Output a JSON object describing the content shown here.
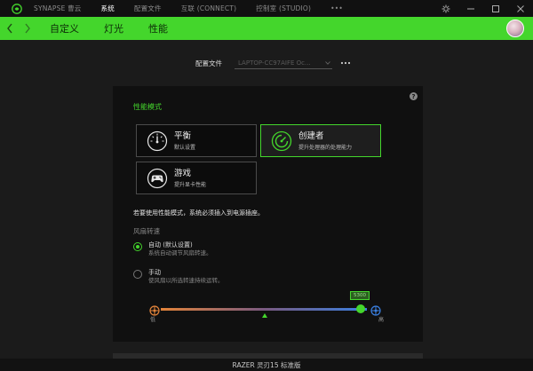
{
  "titlebar": {
    "nav": [
      {
        "label": "SYNAPSE 曹云",
        "active": false
      },
      {
        "label": "系统",
        "active": true
      },
      {
        "label": "配置文件",
        "active": false
      },
      {
        "label": "互联 (CONNECT)",
        "active": false
      },
      {
        "label": "控制室 (STUDIO)",
        "active": false
      },
      {
        "label": "•••",
        "active": false
      }
    ]
  },
  "subnav": {
    "tabs": [
      "自定义",
      "灯光",
      "性能"
    ],
    "active_tab": "性能"
  },
  "profile": {
    "label": "配置文件",
    "value": "LAPTOP-CC97AIFE Oc...",
    "more": "•••"
  },
  "performance": {
    "section_title": "性能模式",
    "modes": [
      {
        "name": "平衡",
        "desc": "默认设置",
        "selected": false,
        "icon": "gauge-icon"
      },
      {
        "name": "创建者",
        "desc": "提升处理器的处理能力",
        "selected": true,
        "icon": "creator-icon"
      },
      {
        "name": "游戏",
        "desc": "提升显卡性能",
        "selected": false,
        "icon": "gamepad-icon"
      }
    ],
    "note": "若要使用性能模式，系统必须插入到电源插座。"
  },
  "fan": {
    "title": "风扇转速",
    "options": [
      {
        "label": "自动 (默认设置)",
        "desc": "系统自动调节风扇转速。",
        "selected": true
      },
      {
        "label": "手动",
        "desc": "使风扇以所选转速持续运转。",
        "selected": false
      }
    ],
    "slider": {
      "value_label": "5300",
      "value_fraction": 0.97,
      "min_label": "低",
      "max_label": "高"
    }
  },
  "footer": {
    "device": "RAZER 灵刃15 标准版"
  },
  "colors": {
    "accent": "#44d62c",
    "background": "#1b1b1b",
    "panel": "#101010"
  }
}
